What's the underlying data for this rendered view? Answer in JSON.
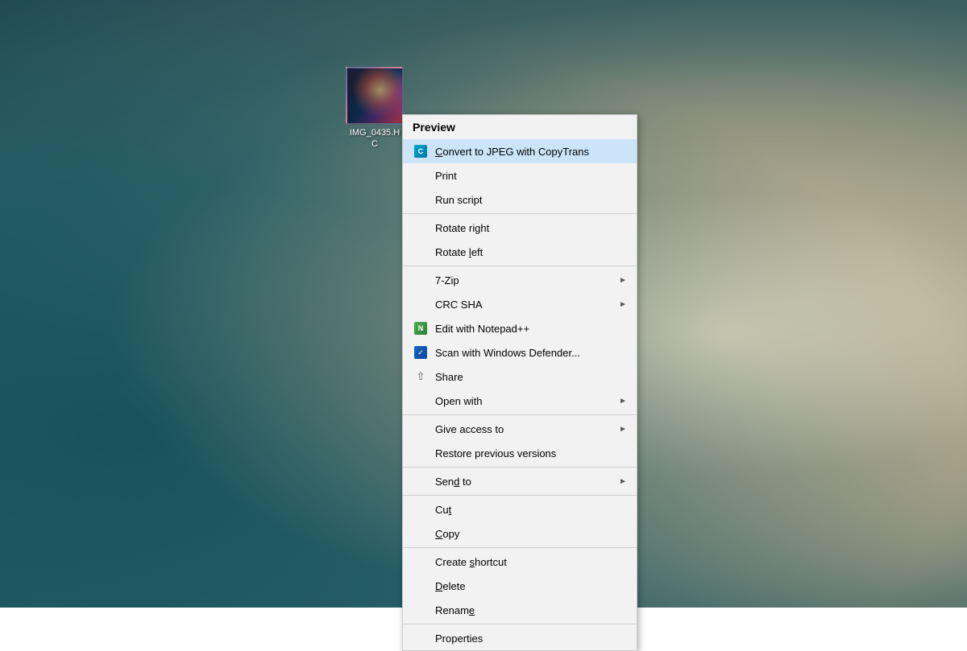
{
  "desktop": {
    "background_desc": "Windows desktop with dandelion/teal wallpaper"
  },
  "file_icon": {
    "name": "IMG_0435.H",
    "label_line1": "IMG_0435.H",
    "label_line2": "C"
  },
  "context_menu": {
    "header": "Preview",
    "items": [
      {
        "id": "convert",
        "label": "Convert to JPEG with CopyTrans",
        "icon": "copytrans",
        "highlighted": true
      },
      {
        "id": "print",
        "label": "Print",
        "icon": null
      },
      {
        "id": "run-script",
        "label": "Run script",
        "icon": null
      },
      {
        "id": "divider1"
      },
      {
        "id": "rotate-right",
        "label": "Rotate right",
        "icon": null
      },
      {
        "id": "rotate-left",
        "label": "Rotate left",
        "icon": null
      },
      {
        "id": "divider2"
      },
      {
        "id": "7zip",
        "label": "7-Zip",
        "icon": null,
        "submenu": true
      },
      {
        "id": "crc-sha",
        "label": "CRC SHA",
        "icon": null,
        "submenu": true
      },
      {
        "id": "edit-notepad",
        "label": "Edit with Notepad++",
        "icon": "notepadpp"
      },
      {
        "id": "scan-defender",
        "label": "Scan with Windows Defender...",
        "icon": "defender"
      },
      {
        "id": "share",
        "label": "Share",
        "icon": "share"
      },
      {
        "id": "open-with",
        "label": "Open with",
        "icon": null,
        "submenu": true
      },
      {
        "id": "divider3"
      },
      {
        "id": "give-access",
        "label": "Give access to",
        "icon": null,
        "submenu": true
      },
      {
        "id": "restore-versions",
        "label": "Restore previous versions",
        "icon": null
      },
      {
        "id": "divider4"
      },
      {
        "id": "send-to",
        "label": "Send to",
        "icon": null,
        "submenu": true
      },
      {
        "id": "divider5"
      },
      {
        "id": "cut",
        "label": "Cut",
        "icon": null
      },
      {
        "id": "copy",
        "label": "Copy",
        "icon": null
      },
      {
        "id": "divider6"
      },
      {
        "id": "create-shortcut",
        "label": "Create shortcut",
        "icon": null
      },
      {
        "id": "delete",
        "label": "Delete",
        "icon": null
      },
      {
        "id": "rename",
        "label": "Rename",
        "icon": null
      },
      {
        "id": "divider7"
      },
      {
        "id": "properties",
        "label": "Properties",
        "icon": null
      }
    ]
  }
}
